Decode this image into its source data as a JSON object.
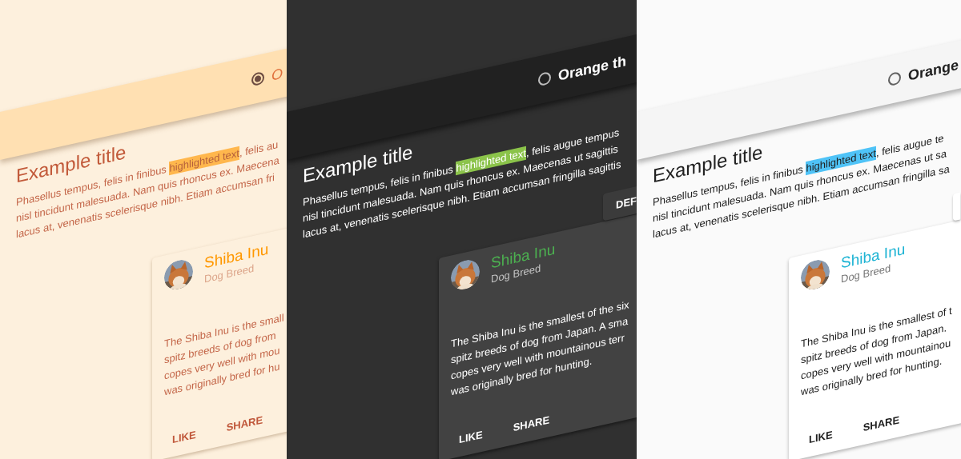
{
  "panels": [
    {
      "kind": "orange",
      "radio": {
        "selected": true,
        "label": "O"
      },
      "title": "Example title",
      "paragraph": {
        "start": "Phasellus tempus, felis in finibus ",
        "highlight": "highlighted text",
        "rest": [
          ", felis au",
          "nisl tincidunt malesuada. Nam quis rhoncus ex. Maecena",
          "lacus at, venenatis scelerisque nibh. Etiam accumsan fri"
        ]
      },
      "card": {
        "avatar": {
          "kind": "picture"
        },
        "title": "Shiba Inu",
        "subtitle": "Dog Breed",
        "lines": [
          "The Shiba Inu is the small",
          "spitz breeds of dog from",
          "copes very well with mou",
          "was originally bred for hu"
        ],
        "actions": [
          "LIKE",
          "SHARE"
        ]
      }
    },
    {
      "kind": "dark",
      "radio": {
        "selected": false,
        "label": "Orange th"
      },
      "title": "Example title",
      "paragraph": {
        "start": "Phasellus tempus, felis in finibus ",
        "highlight": "highlighted text",
        "rest": [
          ", felis augue tempus",
          "nisl tincidunt malesuada. Nam quis rhoncus ex. Maecenas ut sagittis",
          "lacus at, venenatis scelerisque nibh. Etiam accumsan fringilla sagittis"
        ]
      },
      "button": {
        "kind": "raised",
        "label": "DEF"
      },
      "card": {
        "avatar": {
          "kind": "picture"
        },
        "title": "Shiba Inu",
        "subtitle": "Dog Breed",
        "lines": [
          "The Shiba Inu is the smallest of the six",
          "spitz breeds of dog from Japan. A sma",
          "copes very well with mountainous terr",
          "was originally bred for hunting."
        ],
        "actions": [
          "LIKE",
          "SHARE"
        ]
      }
    },
    {
      "kind": "light",
      "radio": {
        "selected": false,
        "label": "Orange"
      },
      "title": "Example title",
      "paragraph": {
        "start": "Phasellus tempus, felis in finibus ",
        "highlight": "highlighted text",
        "rest": [
          ", felis augue te",
          "nisl tincidunt malesuada. Nam quis rhoncus ex. Maecenas ut sa",
          "lacus at, venenatis scelerisque nibh. Etiam accumsan fringilla sa"
        ]
      },
      "button": {
        "kind": "raised"
      },
      "card": {
        "avatar": {
          "kind": "picture"
        },
        "title": "Shiba Inu",
        "subtitle": "Dog Breed",
        "lines": [
          "The Shiba Inu is the smallest of t",
          "spitz breeds of dog from Japan.",
          "copes very well with mountainou",
          "was originally bred for hunting."
        ],
        "actions": [
          "LIKE",
          "SHARE"
        ]
      }
    }
  ]
}
